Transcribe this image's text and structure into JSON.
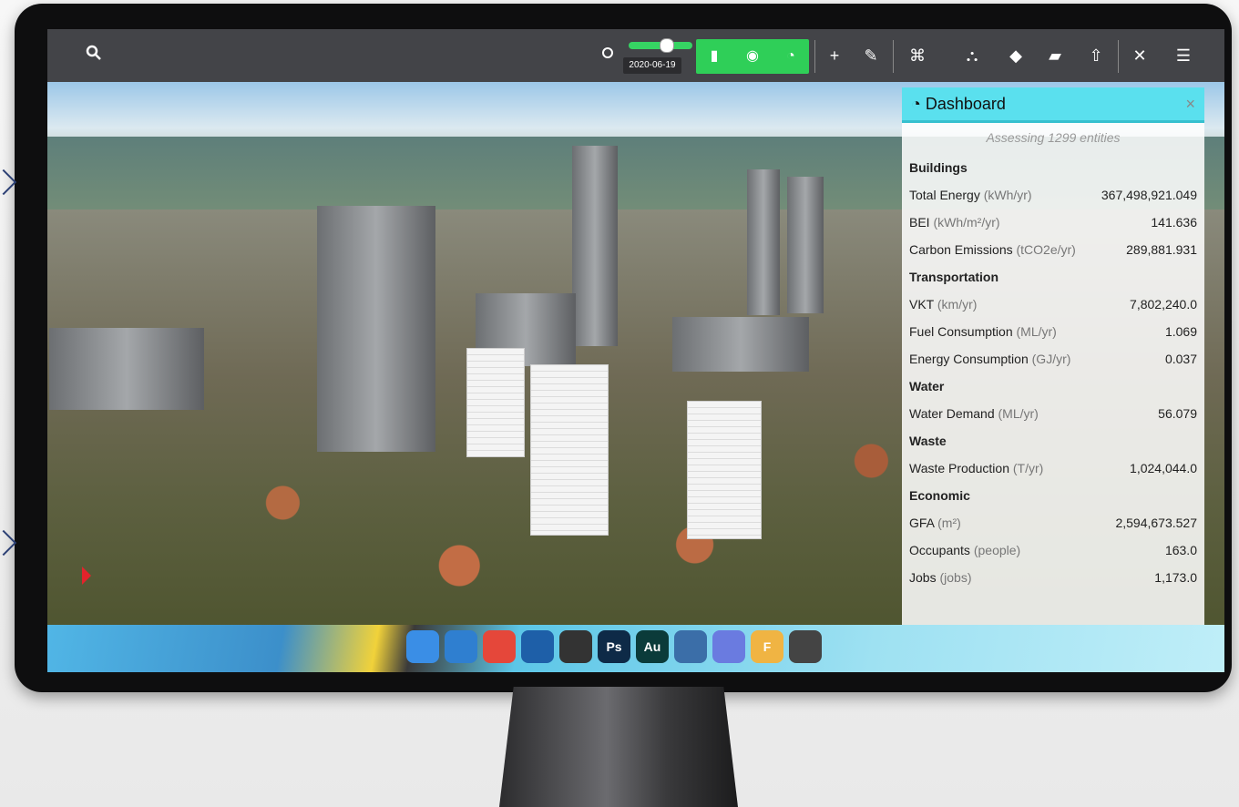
{
  "toolbar": {
    "search_icon": "search-icon",
    "date": "2020-06-19",
    "icons": [
      "search-icon",
      "brightness-icon",
      "building-icon",
      "eye-icon",
      "dashboard-icon",
      "plus-icon",
      "pencil-icon",
      "binoculars-icon",
      "hierarchy-icon",
      "tag-icon",
      "folder-open-icon",
      "upload-icon",
      "close-icon",
      "menu-icon"
    ]
  },
  "dashboard": {
    "title": "Dashboard",
    "close": "×",
    "subtitle": "Assessing 1299 entities",
    "sections": [
      {
        "name": "Buildings",
        "rows": [
          {
            "label": "Total Energy",
            "unit": "(kWh/yr)",
            "value": "367,498,921.049"
          },
          {
            "label": "BEI",
            "unit": "(kWh/m²/yr)",
            "value": "141.636"
          },
          {
            "label": "Carbon Emissions",
            "unit": "(tCO2e/yr)",
            "value": "289,881.931"
          }
        ]
      },
      {
        "name": "Transportation",
        "rows": [
          {
            "label": "VKT",
            "unit": "(km/yr)",
            "value": "7,802,240.0"
          },
          {
            "label": "Fuel Consumption",
            "unit": "(ML/yr)",
            "value": "1.069"
          },
          {
            "label": "Energy Consumption",
            "unit": "(GJ/yr)",
            "value": "0.037"
          }
        ]
      },
      {
        "name": "Water",
        "rows": [
          {
            "label": "Water Demand",
            "unit": "(ML/yr)",
            "value": "56.079"
          }
        ]
      },
      {
        "name": "Waste",
        "rows": [
          {
            "label": "Waste Production",
            "unit": "(T/yr)",
            "value": "1,024,044.0"
          }
        ]
      },
      {
        "name": "Economic",
        "rows": [
          {
            "label": "GFA",
            "unit": "(m²)",
            "value": "2,594,673.527"
          },
          {
            "label": "Occupants",
            "unit": "(people)",
            "value": "163.0"
          },
          {
            "label": "Jobs",
            "unit": "(jobs)",
            "value": "1,173.0"
          }
        ]
      }
    ]
  },
  "dock": {
    "apps": [
      {
        "name": "finder-icon",
        "text": "",
        "color": "#3a8ee6"
      },
      {
        "name": "magnifier-icon",
        "text": "",
        "color": "#2f7fd0"
      },
      {
        "name": "chrome-icon",
        "text": "",
        "color": "#e5473a"
      },
      {
        "name": "quicktime-icon",
        "text": "",
        "color": "#1e5fa8"
      },
      {
        "name": "final-cut-icon",
        "text": "",
        "color": "#333333"
      },
      {
        "name": "photoshop-icon",
        "text": "Ps",
        "color": "#0e2a47"
      },
      {
        "name": "audition-icon",
        "text": "Au",
        "color": "#0b3b3a"
      },
      {
        "name": "aperture-icon",
        "text": "",
        "color": "#3b6ea8"
      },
      {
        "name": "pixelmator-icon",
        "text": "",
        "color": "#6a7be0"
      },
      {
        "name": "fontlab-icon",
        "text": "F",
        "color": "#f0b443"
      },
      {
        "name": "trash-icon",
        "text": "",
        "color": "#444444"
      }
    ]
  }
}
